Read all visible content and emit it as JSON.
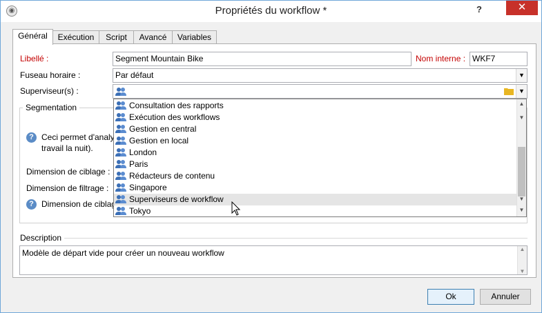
{
  "window": {
    "title": "Propriétés du workflow *",
    "help_label": "?",
    "close_label": "✕"
  },
  "tabs": [
    {
      "label": "Général",
      "active": true
    },
    {
      "label": "Exécution",
      "active": false
    },
    {
      "label": "Script",
      "active": false
    },
    {
      "label": "Avancé",
      "active": false
    },
    {
      "label": "Variables",
      "active": false
    }
  ],
  "general": {
    "label_libelle": "Libellé :",
    "value_libelle": "Segment Mountain Bike",
    "label_nom_interne": "Nom interne :",
    "value_nom_interne": "WKF7",
    "label_fuseau": "Fuseau horaire :",
    "value_fuseau": "Par défaut",
    "label_superviseur": "Superviseur(s) :",
    "value_superviseur": ""
  },
  "segmentation": {
    "title": "Segmentation",
    "info_text_line1": "Ceci permet d'analy",
    "info_text_line2": "travail la nuit).",
    "label_dim_ciblage": "Dimension de ciblage :",
    "label_dim_filtrage": "Dimension de filtrage :",
    "label_dim_ciblage_2": "Dimension de ciblag"
  },
  "dropdown": {
    "items": [
      "Consultation des rapports",
      "Exécution des workflows",
      "Gestion en central",
      "Gestion en local",
      "London",
      "Paris",
      "Rédacteurs de contenu",
      "Singapore",
      "Superviseurs de workflow",
      "Tokyo"
    ],
    "hovered_index": 8
  },
  "description": {
    "title": "Description",
    "text": "Modèle de départ vide pour créer un nouveau workflow"
  },
  "buttons": {
    "ok_label": "Ok",
    "cancel_label": "Annuler"
  },
  "colors": {
    "required_label": "#c40000",
    "close_button": "#c7312a",
    "users_icon": "#3b6fb6"
  }
}
